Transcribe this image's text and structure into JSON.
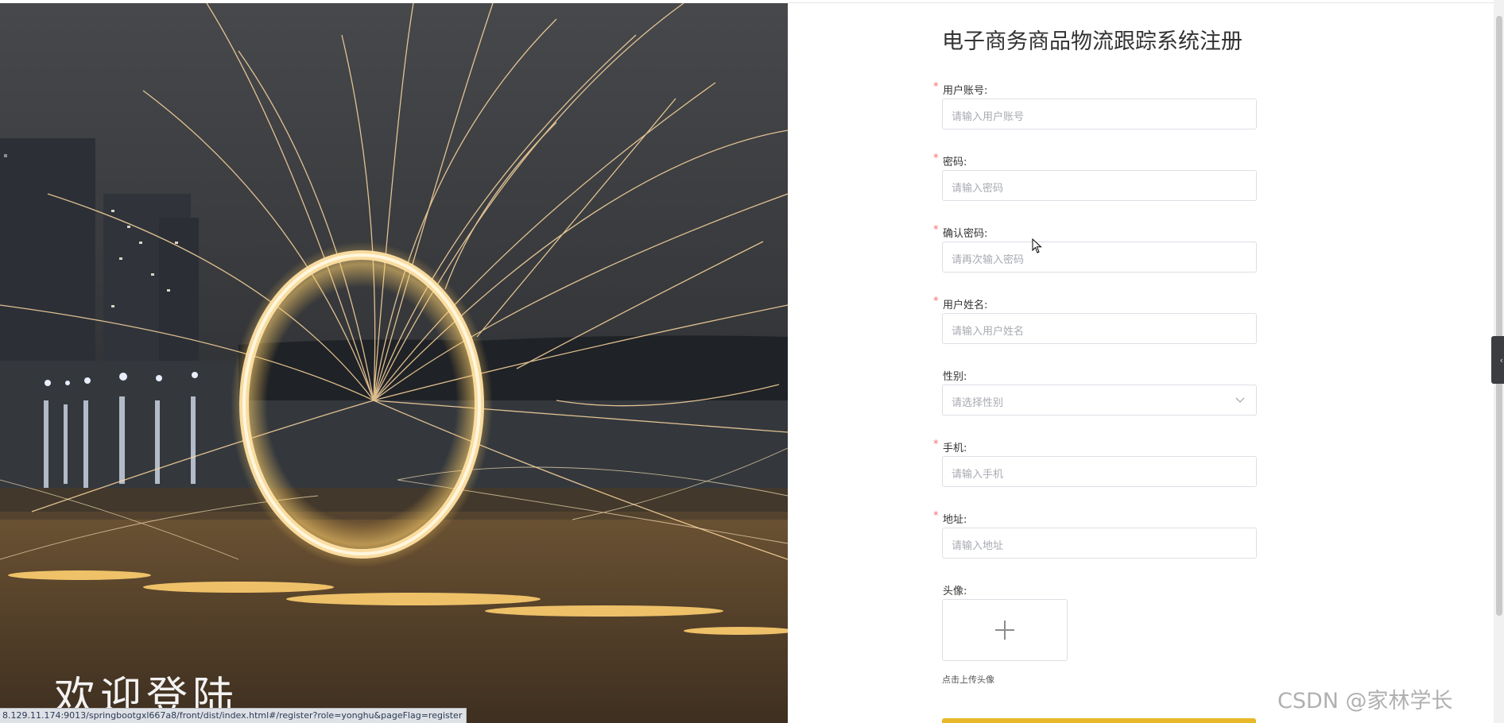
{
  "hero": {
    "overlay_text": "欢迎登陆"
  },
  "form": {
    "title": "电子商务商品物流跟踪系统注册",
    "required_mark": "*",
    "fields": [
      {
        "label": "用户账号:",
        "placeholder": "请输入用户账号",
        "required": true
      },
      {
        "label": "密码:",
        "placeholder": "请输入密码",
        "required": true
      },
      {
        "label": "确认密码:",
        "placeholder": "请再次输入密码",
        "required": true
      },
      {
        "label": "用户姓名:",
        "placeholder": "请输入用户姓名",
        "required": true
      },
      {
        "label": "性别:",
        "placeholder": "请选择性别",
        "required": false
      },
      {
        "label": "手机:",
        "placeholder": "请输入手机",
        "required": true
      },
      {
        "label": "地址:",
        "placeholder": "请输入地址",
        "required": true
      }
    ],
    "avatar": {
      "label": "头像:",
      "hint": "点击上传头像",
      "icon": "plus-icon"
    }
  },
  "status_url": "8.129.11.174:9013/springbootgxl667a8/front/dist/index.html#/register?role=yonghu&pageFlag=register",
  "watermark": "CSDN @家林学长",
  "colors": {
    "required": "#f56c6c",
    "submit": "#e7b928",
    "border": "#dcdfe6",
    "placeholder": "#a8abb2"
  },
  "icons": {
    "select": "chevron-down-icon",
    "side_tab": "chevron-left-icon",
    "cursor": "mouse-cursor-icon"
  }
}
